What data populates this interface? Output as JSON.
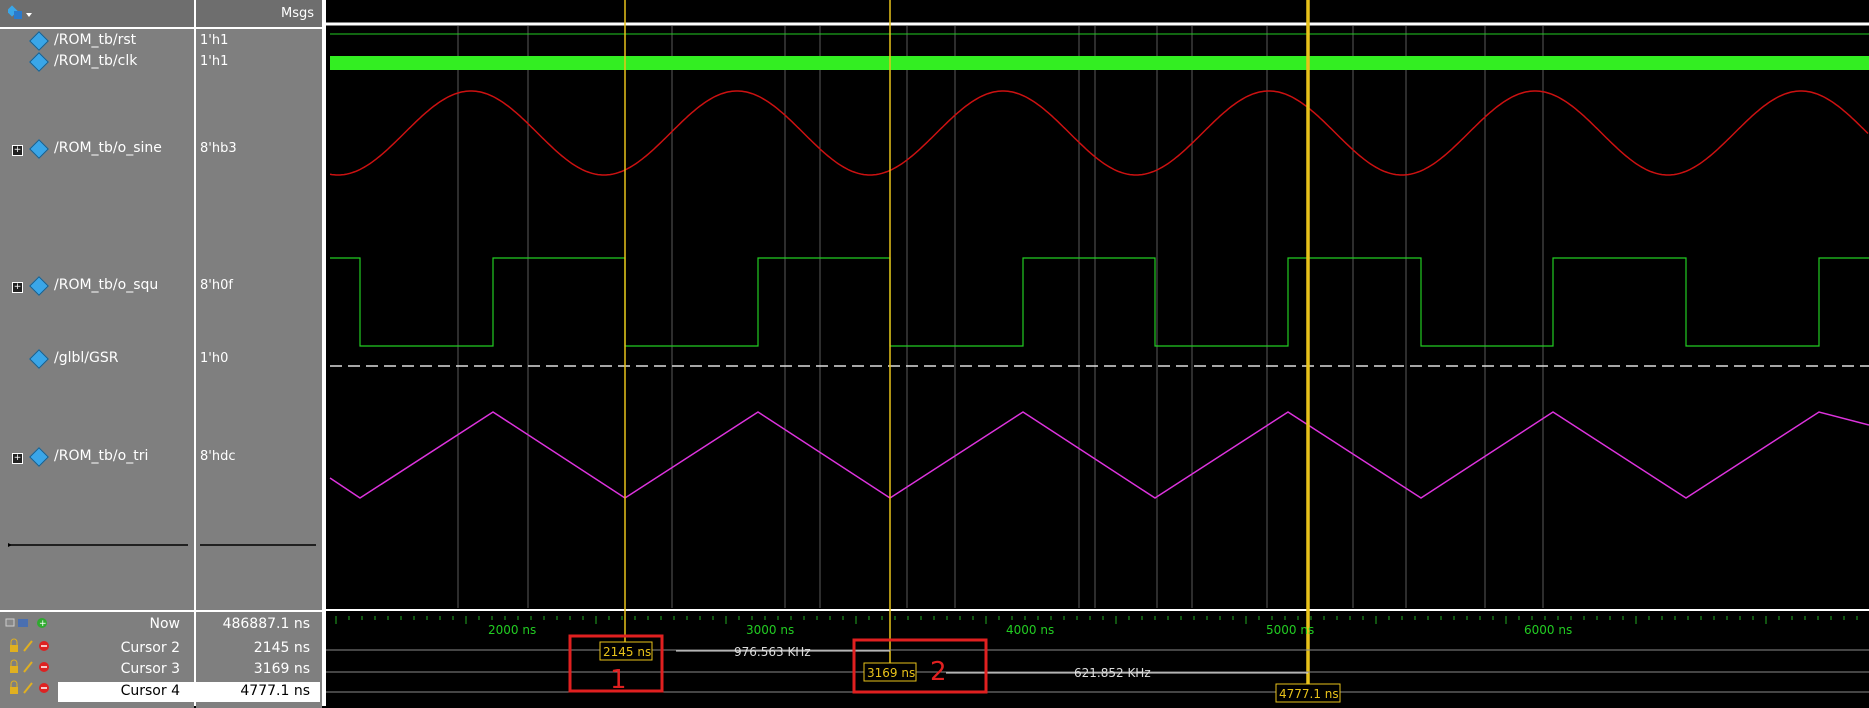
{
  "header": {
    "msgs": "Msgs"
  },
  "signals": [
    {
      "name": "/ROM_tb/rst",
      "value": "1'h1"
    },
    {
      "name": "/ROM_tb/clk",
      "value": "1'h1"
    },
    {
      "name": "/ROM_tb/o_sine",
      "value": "8'hb3"
    },
    {
      "name": "/ROM_tb/o_squ",
      "value": "8'h0f"
    },
    {
      "name": "/glbl/GSR",
      "value": "1'h0"
    },
    {
      "name": "/ROM_tb/o_tri",
      "value": "8'hdc"
    }
  ],
  "cursors": {
    "now": {
      "label": "Now",
      "value": "486887.1 ns"
    },
    "c2": {
      "label": "Cursor 2",
      "value": "2145 ns",
      "tag": "2145 ns"
    },
    "c3": {
      "label": "Cursor 3",
      "value": "3169 ns",
      "tag": "3169 ns"
    },
    "c4": {
      "label": "Cursor 4",
      "value": "4777.1 ns",
      "tag": "4777.1 ns"
    }
  },
  "measurements": {
    "freq1": "976.563 KHz",
    "freq2": "621.852 KHz"
  },
  "annotations": {
    "box1": "1",
    "box2": "2"
  },
  "timeline": {
    "ticks": [
      "2000 ns",
      "3000 ns",
      "4000 ns",
      "5000 ns",
      "6000 ns"
    ]
  },
  "colors": {
    "clk": "#33ee22",
    "sine": "#cc1111",
    "square": "#22cc22",
    "tri": "#dd33dd",
    "cursor": "#e8c21a",
    "annotation": "#e02020",
    "grid": "#5a5a5a"
  }
}
